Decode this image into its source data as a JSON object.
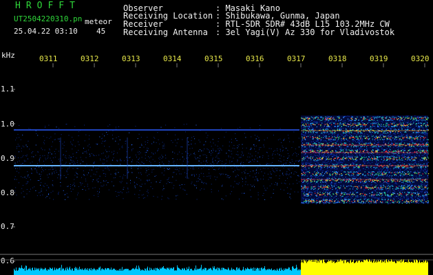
{
  "header": {
    "app_title": "HROFFT",
    "file_name": "UT2504220310.pn",
    "mode_label": "meteor",
    "timestamp": "25.04.22 03:10",
    "count": "45",
    "observer_label": "Observer",
    "observer_value": ": Masaki Kano",
    "location_label": "Receiving Location",
    "location_value": ": Shibukawa, Gunma, Japan",
    "receiver_label": "Receiver",
    "receiver_value": ": RTL-SDR SDR# 43dB L15 103.2MHz CW",
    "antenna_label": "Receiving Antenna",
    "antenna_value": ": 3el Yagi(V) Az 330 for Vladivostok"
  },
  "axis": {
    "unit": "kHz",
    "time_ticks": [
      "0311",
      "0312",
      "0313",
      "0314",
      "0315",
      "0316",
      "0317",
      "0318",
      "0319",
      "0320"
    ],
    "freq_ticks": [
      "1.1",
      "1.0",
      "0.9",
      "0.8",
      "0.7",
      "0.6"
    ]
  },
  "colors": {
    "background": "#000000",
    "title": "#2fd83a",
    "time_ticks": "#e8e84a",
    "trace": "#1e90ff",
    "signal": "#ff3030",
    "level_low": "#00bfff",
    "level_high": "#ffff00"
  }
}
